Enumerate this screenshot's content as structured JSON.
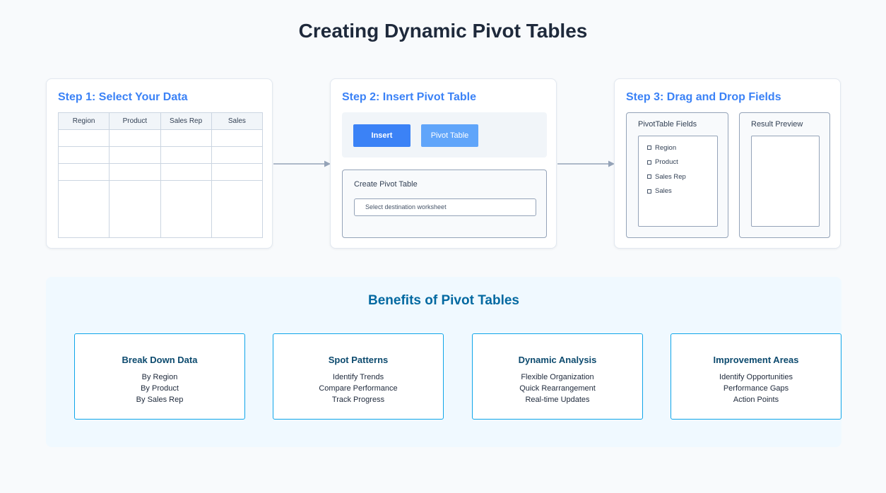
{
  "page": {
    "title": "Creating Dynamic Pivot Tables"
  },
  "step1": {
    "title": "Step 1: Select Your Data",
    "columns": [
      "Region",
      "Product",
      "Sales Rep",
      "Sales"
    ]
  },
  "step2": {
    "title": "Step 2: Insert Pivot Table",
    "insert_label": "Insert",
    "pivot_label": "Pivot Table",
    "dialog_title": "Create Pivot Table",
    "dest_placeholder": "Select destination worksheet"
  },
  "step3": {
    "title": "Step 3: Drag and Drop Fields",
    "fields_title": "PivotTable Fields",
    "fields": [
      "Region",
      "Product",
      "Sales Rep",
      "Sales"
    ],
    "preview_title": "Result Preview"
  },
  "benefits": {
    "title": "Benefits of Pivot Tables",
    "cards": [
      {
        "title": "Break Down Data",
        "items": [
          "By Region",
          "By Product",
          "By Sales Rep"
        ]
      },
      {
        "title": "Spot Patterns",
        "items": [
          "Identify Trends",
          "Compare Performance",
          "Track Progress"
        ]
      },
      {
        "title": "Dynamic Analysis",
        "items": [
          "Flexible Organization",
          "Quick Rearrangement",
          "Real-time Updates"
        ]
      },
      {
        "title": "Improvement Areas",
        "items": [
          "Identify Opportunities",
          "Performance Gaps",
          "Action Points"
        ]
      }
    ]
  },
  "colors": {
    "accent": "#3b82f6",
    "benefit_border": "#0ea5e9",
    "benefit_title": "#0369a1"
  }
}
